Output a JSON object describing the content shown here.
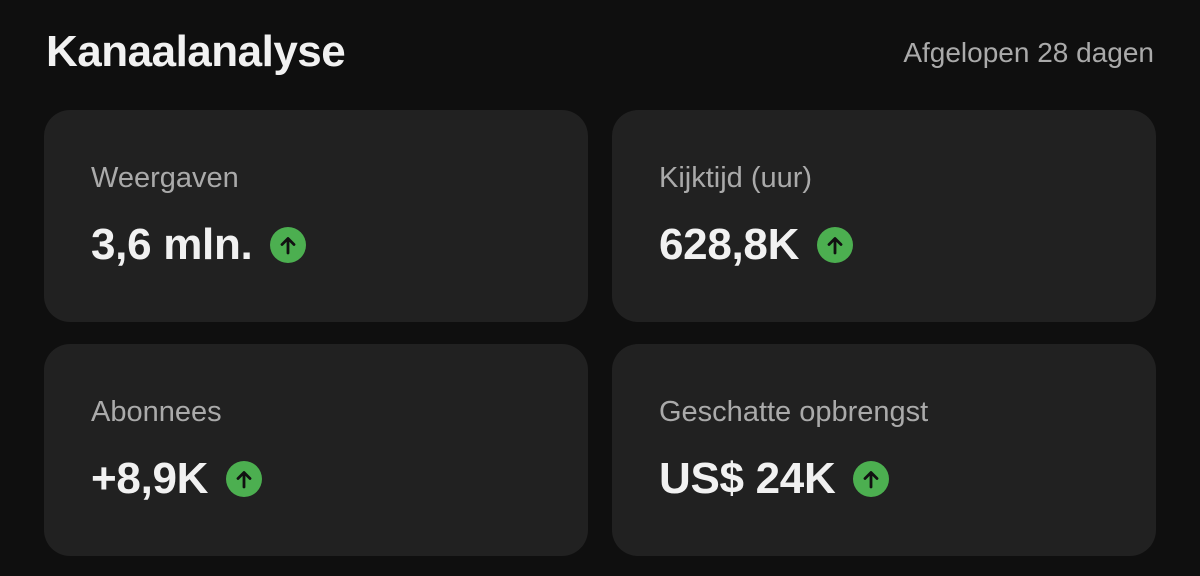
{
  "header": {
    "title": "Kanaalanalyse",
    "period": "Afgelopen 28 dagen"
  },
  "cards": [
    {
      "label": "Weergaven",
      "value": "3,6 mln.",
      "trend_icon": "arrow-up-icon"
    },
    {
      "label": "Kijktijd (uur)",
      "value": "628,8K",
      "trend_icon": "arrow-up-icon"
    },
    {
      "label": "Abonnees",
      "value": "+8,9K",
      "trend_icon": "arrow-up-icon"
    },
    {
      "label": "Geschatte opbrengst",
      "value": "US$ 24K",
      "trend_icon": "arrow-up-icon"
    }
  ],
  "colors": {
    "background": "#0f0f0f",
    "card": "#212121",
    "trend_up": "#4caf50",
    "text_primary": "#f1f1f1",
    "text_secondary": "#aaaaaa"
  }
}
